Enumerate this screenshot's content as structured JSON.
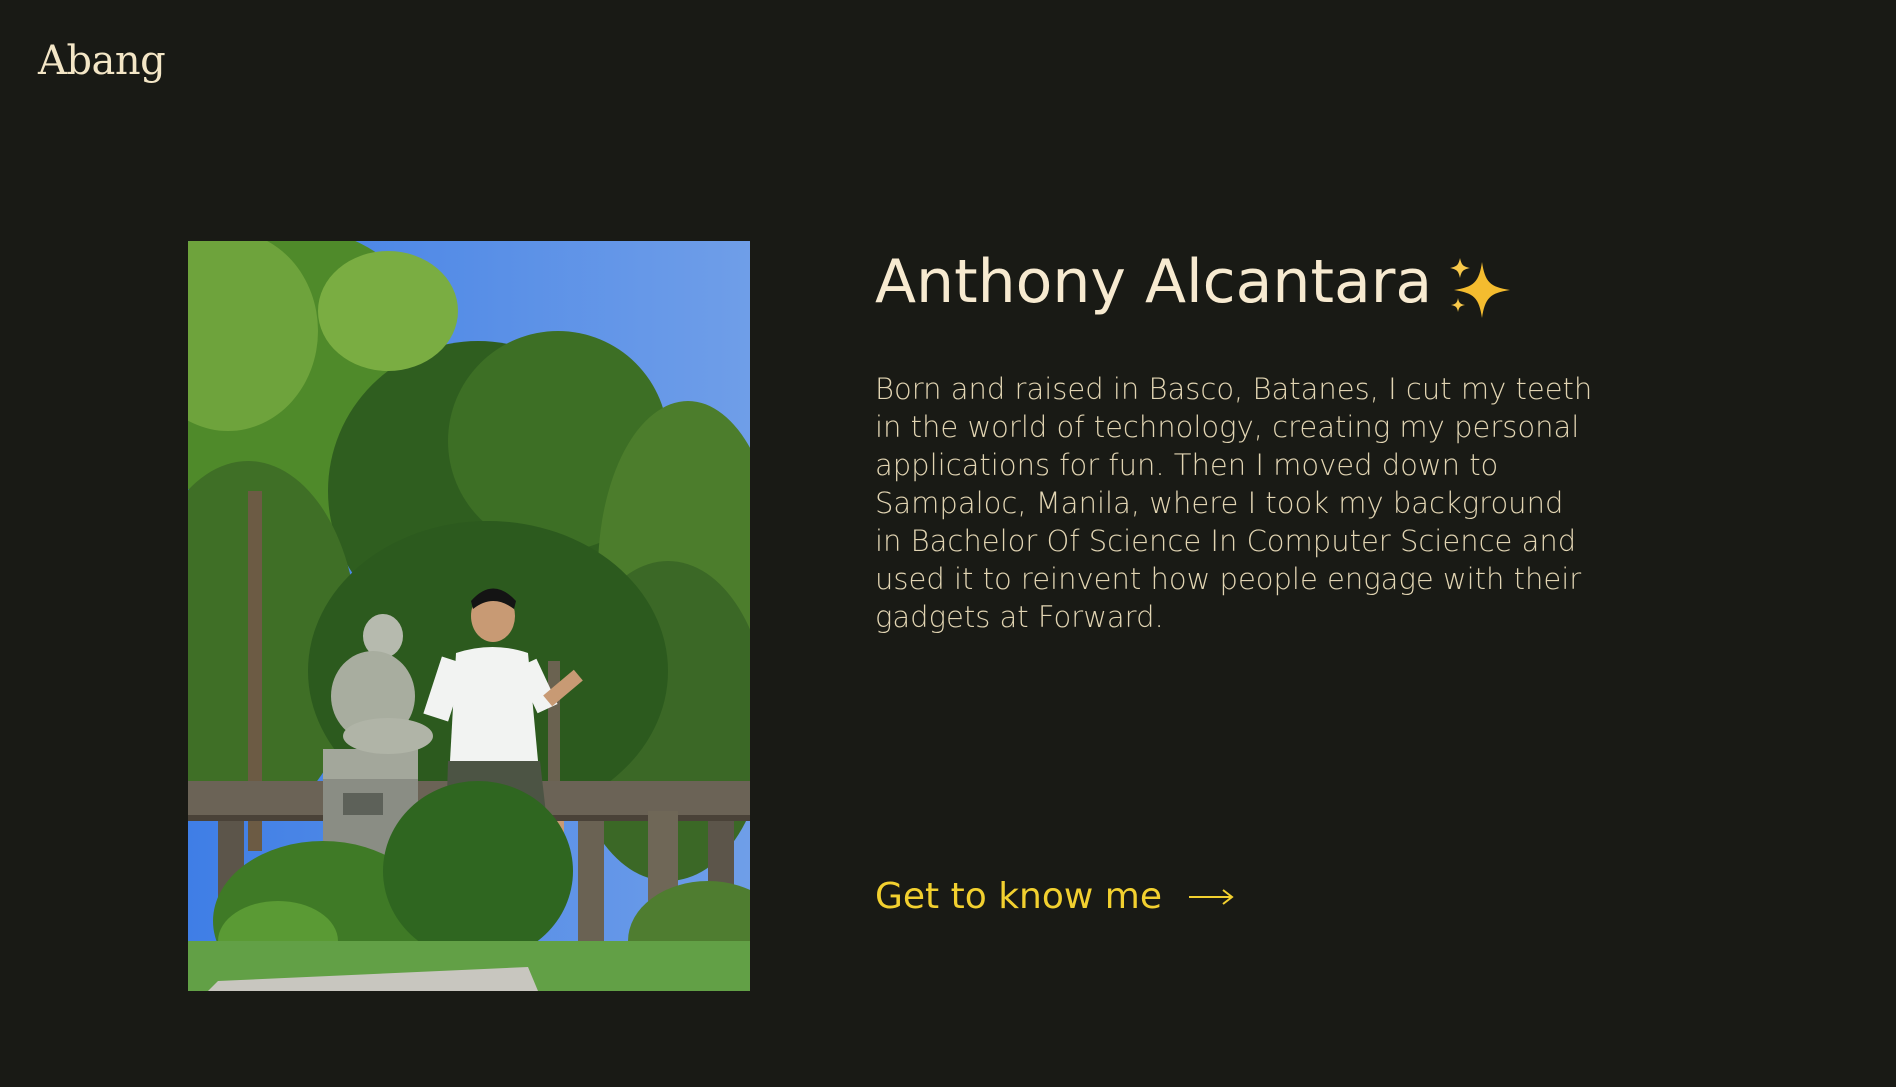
{
  "header": {
    "logo_text": "Abang"
  },
  "profile": {
    "photo_icon": "portrait-photo",
    "name": "Anthony Alcantara",
    "name_emoji_icon": "sparkles-icon",
    "bio": "Born and raised in Basco, Batanes, I cut my teeth in the world of technology, creating my personal applications for fun. Then I moved down to Sampaloc, Manila, where I took my background in Bachelor Of Science In Computer Science and used it to reinvent how people engage with their gadgets at Forward."
  },
  "cta": {
    "label": "Get to know me",
    "arrow_icon": "long-arrow-right-icon"
  },
  "colors": {
    "background": "#191a15",
    "text": "#f7ead0",
    "accent": "#f2d02f",
    "sparkle": "#f4bc2f"
  }
}
